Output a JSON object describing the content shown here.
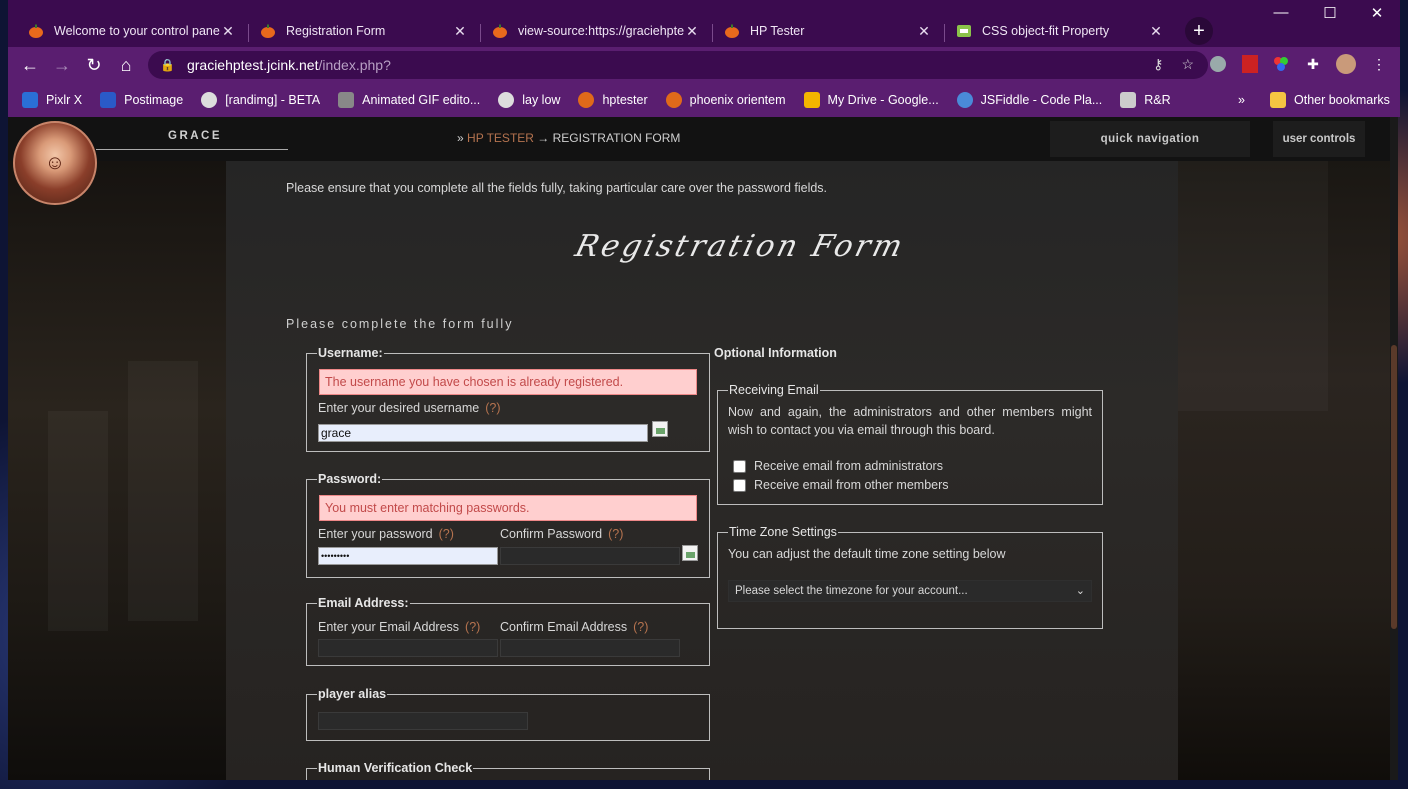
{
  "browser": {
    "tabs": [
      {
        "title": "Welcome to your control panel",
        "active": false
      },
      {
        "title": "Registration Form",
        "active": false
      },
      {
        "title": "view-source:https://graciehptest",
        "active": false
      },
      {
        "title": "HP Tester",
        "active": false
      },
      {
        "title": "CSS object-fit Property",
        "active": false
      }
    ],
    "close_glyph": "✕",
    "new_tab_glyph": "+",
    "url_host": "graciehptest.jcink.net",
    "url_path": "/index.php?",
    "bookmarks": [
      {
        "label": "Pixlr X",
        "icon": "pixlr-icon",
        "color": "#2a6fd6"
      },
      {
        "label": "Postimage",
        "icon": "postimage-icon",
        "color": "#2a5ac8"
      },
      {
        "label": "[randimg] - BETA",
        "icon": "globe-icon",
        "color": "#dddddd"
      },
      {
        "label": "Animated GIF edito...",
        "icon": "gif-icon",
        "color": "#888888"
      },
      {
        "label": "lay low",
        "icon": "globe-icon",
        "color": "#dddddd"
      },
      {
        "label": "hptester",
        "icon": "pumpkin-icon",
        "color": "#e06a1a"
      },
      {
        "label": "phoenix orientem",
        "icon": "pumpkin-icon",
        "color": "#e06a1a"
      },
      {
        "label": "My Drive - Google...",
        "icon": "drive-icon",
        "color": "#f4b400"
      },
      {
        "label": "JSFiddle - Code Pla...",
        "icon": "jsfiddle-icon",
        "color": "#4a8ad8"
      },
      {
        "label": "R&R",
        "icon": "wizard-icon",
        "color": "#cccccc"
      }
    ],
    "other_bookmarks": "Other bookmarks",
    "colors": {
      "chrome": "#3b0b4f",
      "toolbar": "#5a1e70"
    }
  },
  "site": {
    "username_header": "GRACE",
    "breadcrumb_prefix": "»",
    "breadcrumb_link": "HP TESTER",
    "breadcrumb_current": "→ REGISTRATION FORM",
    "quick_navigation": "quick navigation",
    "user_controls": "user controls",
    "accent": "#b5734f"
  },
  "form": {
    "intro": "Please ensure that you complete all the fields fully, taking particular care over the password fields.",
    "title": "Registration Form",
    "subtitle": "Please complete the form fully",
    "help_mark": "(?)",
    "username": {
      "legend": "Username:",
      "error": "The username you have chosen is already registered.",
      "label": "Enter your desired username",
      "value": "grace"
    },
    "password": {
      "legend": "Password:",
      "error": "You must enter matching passwords.",
      "label": "Enter your password",
      "confirm_label": "Confirm Password",
      "value": "•••••••••"
    },
    "email": {
      "legend": "Email Address:",
      "label": "Enter your Email Address",
      "confirm_label": "Confirm Email Address"
    },
    "alias": {
      "legend": "player alias"
    },
    "verification": {
      "legend": "Human Verification Check"
    },
    "optional": {
      "title": "Optional Information",
      "receiving": {
        "legend": "Receiving Email",
        "text": "Now and again, the administrators and other members might wish to contact you via email through this board.",
        "opt_admin": "Receive email from administrators",
        "opt_members": "Receive email from other members"
      },
      "timezone": {
        "legend": "Time Zone Settings",
        "text": "You can adjust the default time zone setting below",
        "select": "Please select the timezone for your account..."
      }
    }
  }
}
